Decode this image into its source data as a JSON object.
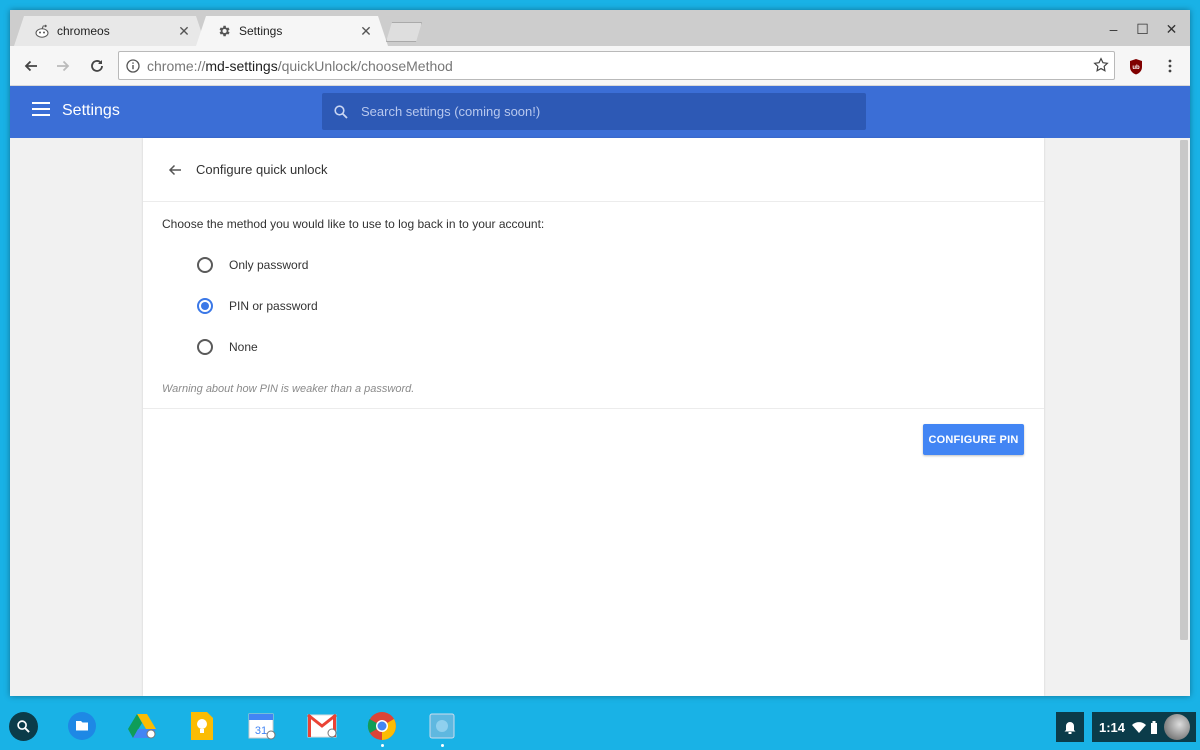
{
  "tabs": [
    {
      "title": "chromeos",
      "favicon": "reddit-icon",
      "active": false
    },
    {
      "title": "Settings",
      "favicon": "gear-icon",
      "active": true
    }
  ],
  "window_controls": {
    "minimize": "–",
    "maximize": "☐",
    "close": "✕"
  },
  "omnibox": {
    "scheme": "chrome://",
    "host": "md-settings",
    "path": "/quickUnlock/chooseMethod"
  },
  "settings_header": {
    "title": "Settings",
    "search_placeholder": "Search settings (coming soon!)"
  },
  "page": {
    "title": "Configure quick unlock",
    "prompt": "Choose the method you would like to use to log back in to your account:",
    "options": [
      {
        "label": "Only password",
        "checked": false
      },
      {
        "label": "PIN or password",
        "checked": true
      },
      {
        "label": "None",
        "checked": false
      }
    ],
    "warning": "Warning about how PIN is weaker than a password.",
    "configure_button": "CONFIGURE PIN"
  },
  "shelf": {
    "apps": [
      "files-icon",
      "drive-icon",
      "keep-icon",
      "calendar-icon",
      "gmail-icon",
      "chrome-icon",
      "settings-app-icon"
    ],
    "calendar_day": "31",
    "time": "1:14"
  },
  "colors": {
    "accent": "#3b6ed6",
    "button": "#4285f4",
    "desktop": "#19b2e6"
  }
}
